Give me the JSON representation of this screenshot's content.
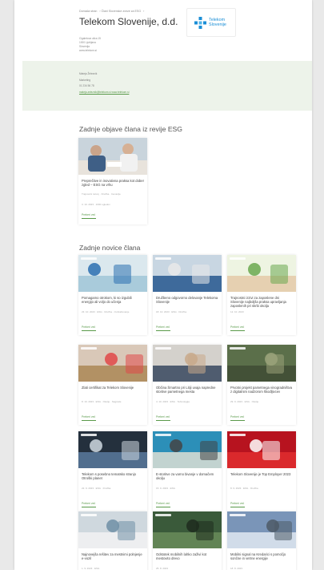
{
  "breadcrumb": [
    "Domača stran",
    "Člani Slovenske zveze za ESG"
  ],
  "company": {
    "name": "Telekom Slovenije, d.d.",
    "logo_text_line1": "Telekom",
    "logo_text_line2": "Slovenije",
    "address_lines": [
      "Cigaletova ulica 15",
      "1000 Ljubljana",
      "Slovenija",
      "www.telekom.si"
    ]
  },
  "contact": {
    "lines": [
      "Mateja Železnik",
      "Marketing",
      "01 234 56 78"
    ],
    "links": "mateja.zeleznik@telekom.si  www.telekom.si"
  },
  "colors": {
    "accent": "#5a9a4a",
    "band": "#edf3ea",
    "logo_blue": "#1a8ed6"
  },
  "esg_section": {
    "title": "Zadnje objave člana iz revije ESG",
    "cards": [
      {
        "title": "Preprečitve in inovativna praksa kot dober zgled – ESG na vrhu",
        "meta": "Trajnostni razvoj · Družba · Inovacije",
        "date": "3. 10. 2023 · 1000 ogledov",
        "more": "Preberi več"
      }
    ]
  },
  "news_section": {
    "title": "Zadnje novice člana",
    "read_more": "Preberi več",
    "cards": [
      {
        "title": "Pomagamo otrokom, ki so izgubili energijo ali voljo do učenja",
        "meta": "23. 10. 2023 · ESG · Družba · Izobraževanje",
        "icon": "school-photo"
      },
      {
        "title": "Družbeno odgovorno delovanje Telekoma Slovenije",
        "meta": "18. 10. 2023 · ESG · Družba",
        "icon": "team-photo"
      },
      {
        "title": "Trajnostni izzivi za zaposlene dni Slovenije najboljša praksa upravljanja zaposlenih pri skrbi okolja",
        "meta": "12. 10. 2023",
        "icon": "illustration"
      },
      {
        "title": "Zlati certifikat za Telekom Slovenije",
        "meta": "8. 10. 2023 · ESG · Okolje · Nagrade",
        "icon": "award-photo"
      },
      {
        "title": "Občina Šmartno pri Litiji uvaja napredne storitve pametnega mesta",
        "meta": "4. 10. 2023 · ESG · Tehnologija",
        "icon": "meeting-photo"
      },
      {
        "title": "Prvotni projekt pametnega vinogradništva z digitalnim nadzorom škodljivcev",
        "meta": "29. 9. 2023 · ESG · Okolje",
        "icon": "vineyard-photo"
      },
      {
        "title": "Telekom s posebno tematsko stranjo Otroški planet",
        "meta": "22. 9. 2023 · ESG · Družba",
        "icon": "web-photo"
      },
      {
        "title": "E-storitve za varno bivanje v domačem okolju",
        "meta": "15. 9. 2023 · ESG",
        "icon": "device-photo"
      },
      {
        "title": "Telekom Slovenije je Top Employer 2023",
        "meta": "8. 9. 2023 · ESG · Družba",
        "icon": "award-red"
      },
      {
        "title": "Najnovejša rešitev za mestnimi polnjenje e-vozil",
        "meta": "1. 9. 2023 · ESG",
        "icon": "ev-photo"
      },
      {
        "title": "Odstotek mobilnih lahko zaživi kot mestovito drevo",
        "meta": "25. 8. 2023",
        "icon": "tree-photo"
      },
      {
        "title": "Mobilni signal na Kredarici s pomočjo sončne in vetrne energije",
        "meta": "18. 8. 2023",
        "icon": "mountain-photo"
      }
    ]
  }
}
